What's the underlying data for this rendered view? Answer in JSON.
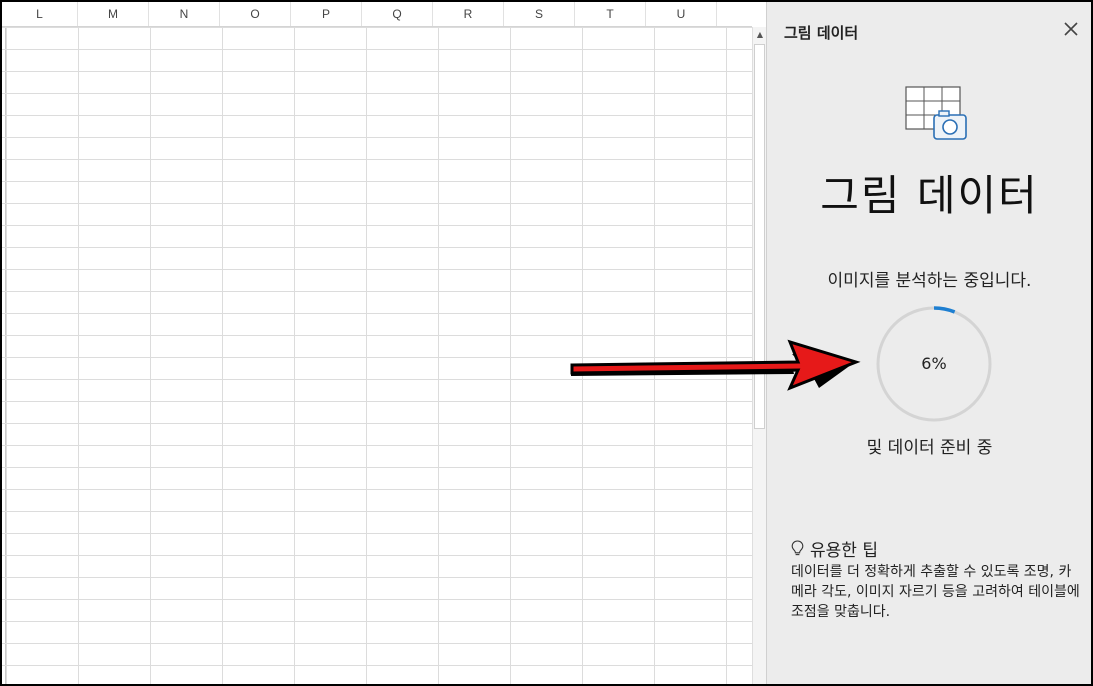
{
  "spreadsheet": {
    "columns": [
      "L",
      "M",
      "N",
      "O",
      "P",
      "Q",
      "R",
      "S",
      "T",
      "U"
    ]
  },
  "pane": {
    "title": "그림 데이터",
    "hero_title": "그림 데이터",
    "status_text": "이미지를 분석하는 중입니다.",
    "progress": 0.06,
    "progress_label": "6%",
    "sub_status": "및 데이터 준비 중",
    "tip_heading": "유용한 팁",
    "tip_body": "데이터를 더 정확하게 추출할 수 있도록 조명, 카메라 각도, 이미지 자르기 등을 고려하여 테이블에 조점을 맞춥니다."
  },
  "icons": {
    "close": "close-icon",
    "hero": "table-camera-icon",
    "tip": "lightbulb-icon"
  },
  "colors": {
    "progress_accent": "#1e7fd1",
    "progress_track": "#d4d4d4",
    "arrow_fill": "#e61919"
  }
}
